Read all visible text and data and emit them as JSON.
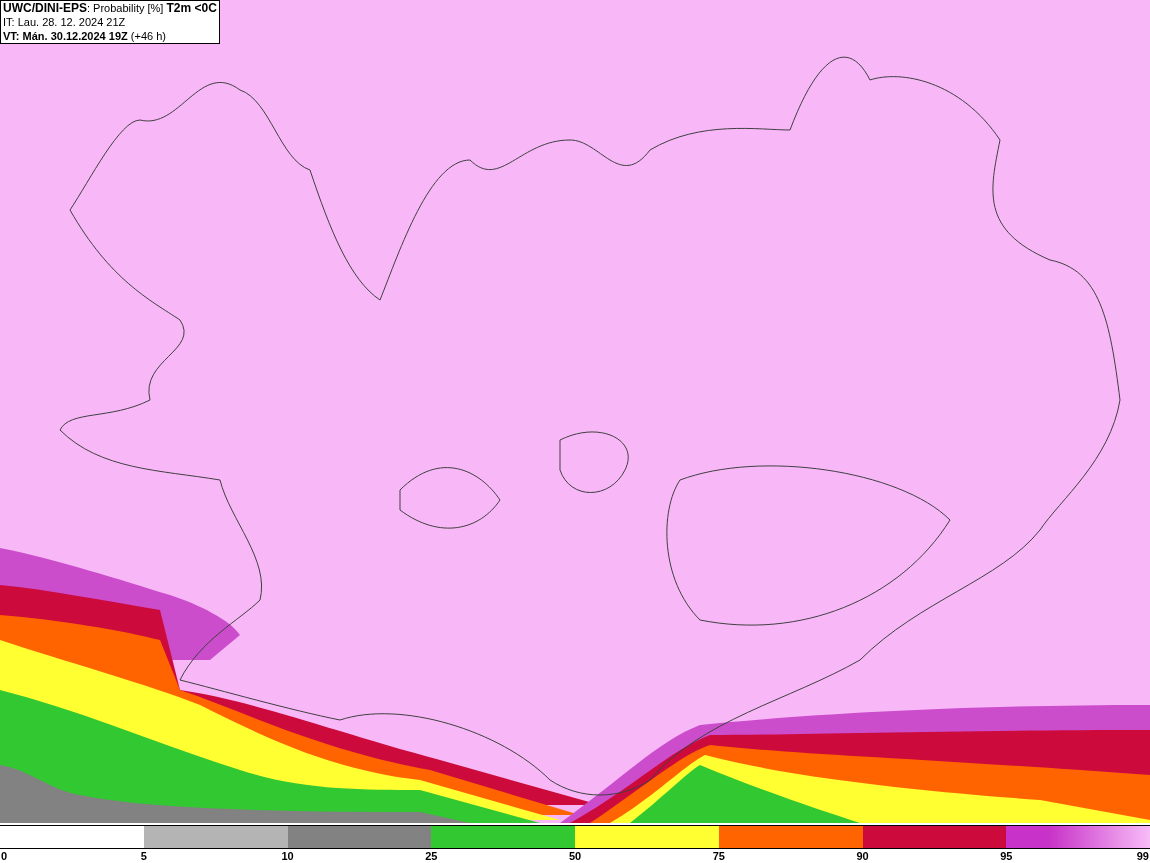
{
  "header": {
    "title": "UWC/DINI-EPS",
    "subtitle": ": Probability [%]",
    "parameter": "T2m <0C",
    "initial_time": "IT: Lau. 28. 12. 2024 21Z",
    "valid_label": "VT: Mán. 30.12.2024 19Z",
    "valid_offset": "(+46 h)"
  },
  "legend": {
    "labels": [
      "0",
      "5",
      "10",
      "25",
      "50",
      "75",
      "90",
      "95",
      "99"
    ],
    "segments": [
      {
        "color": "#b4b4b4"
      },
      {
        "color": "#828282"
      },
      {
        "color": "#32c832"
      },
      {
        "color": "#ffff32"
      },
      {
        "color": "#ff6400"
      },
      {
        "color": "#cd0a3c"
      },
      {
        "color": "#c832c8",
        "kind": "gradient"
      }
    ]
  }
}
